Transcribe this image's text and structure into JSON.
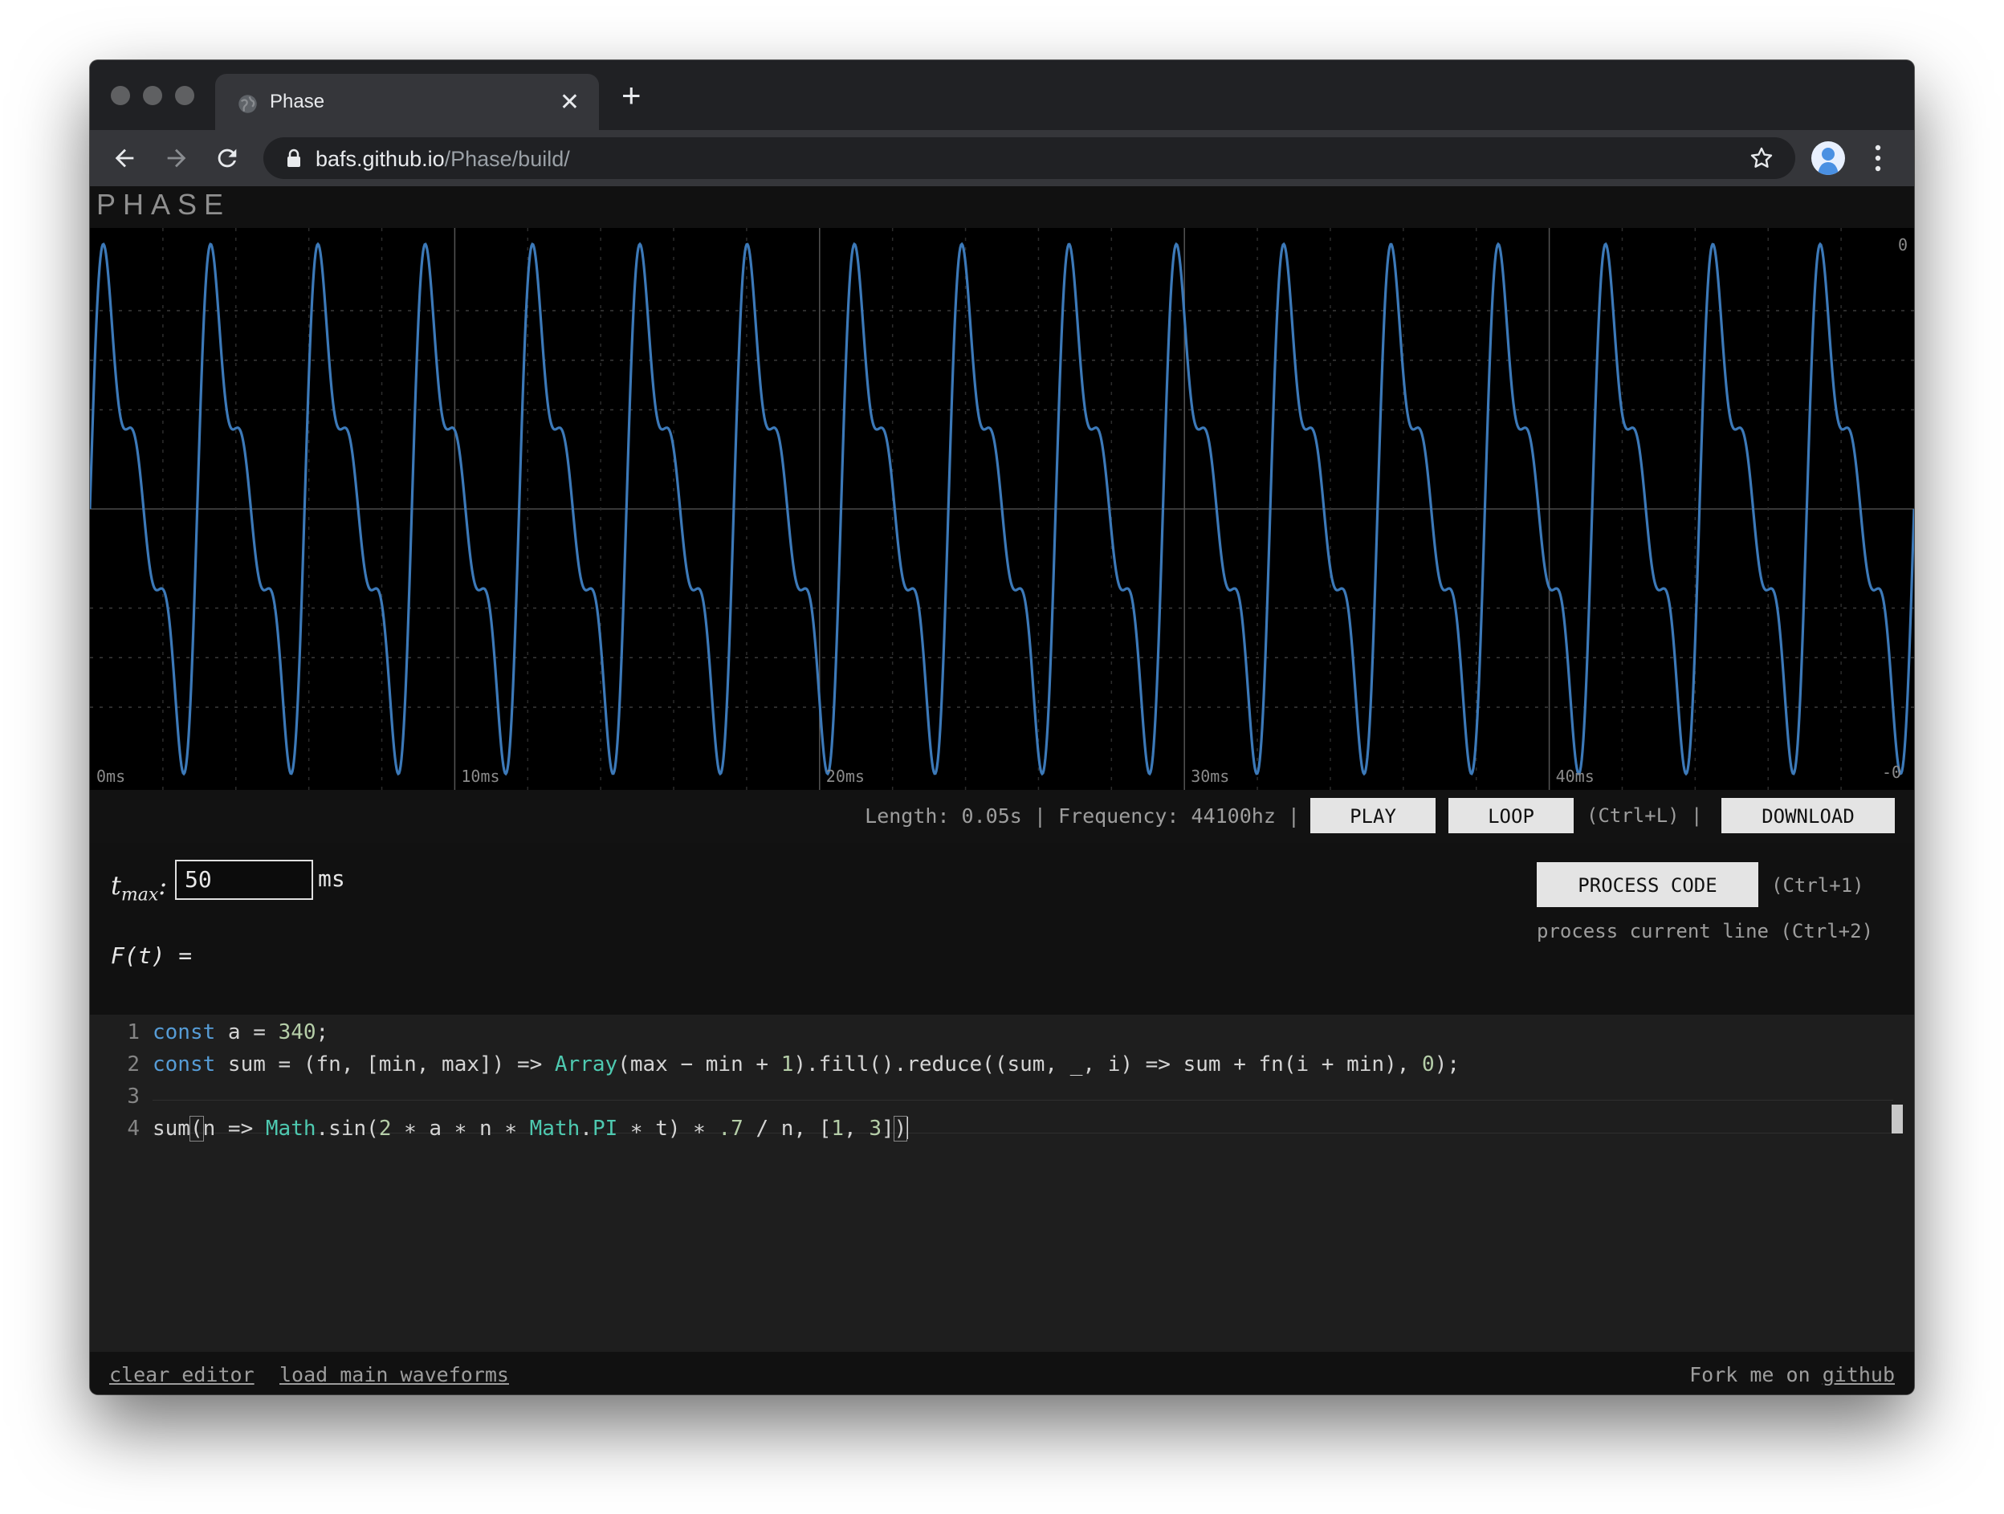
{
  "browser": {
    "tab_title": "Phase",
    "url_host": "bafs.github.io",
    "url_path": "/Phase/build/"
  },
  "app": {
    "brand": "PHASE"
  },
  "scope": {
    "time_labels": [
      "0ms",
      "10ms",
      "20ms",
      "30ms",
      "40ms"
    ],
    "y_top_label": "0",
    "y_bottom_label": "-0",
    "line_color": "#3c79b8"
  },
  "chart_data": {
    "type": "line",
    "x": [
      0,
      10,
      20,
      30,
      40
    ],
    "x_unit": "ms",
    "xlim": [
      0,
      50
    ],
    "ylim": [
      -1,
      1
    ],
    "tick_labels": [
      "0ms",
      "10ms",
      "20ms",
      "30ms",
      "40ms"
    ],
    "grid": true,
    "series": [
      {
        "frequency_hz": 340,
        "harmonics": [
          1,
          2,
          3
        ],
        "amplitude_per_harmonic": "0.7/n"
      }
    ]
  },
  "controls": {
    "info": "Length: 0.05s | Frequency: 44100hz |",
    "play_label": "PLAY",
    "loop_label": "LOOP",
    "loop_hint": "(Ctrl+L) |",
    "download_label": "DOWNLOAD",
    "process_label": "PROCESS CODE",
    "process_hint": "(Ctrl+1)",
    "process_line": "process current line (Ctrl+2)"
  },
  "tmax": {
    "label_main": "t",
    "label_sub": "max",
    "colon": ":",
    "value": "50",
    "unit": "ms"
  },
  "formula_label": "F(t) =",
  "editor": {
    "line_numbers": [
      "1",
      "2",
      "3",
      "4"
    ]
  },
  "footer": {
    "clear_label": "clear editor",
    "load_label": "load main waveforms",
    "fork_text": "Fork me on",
    "github_label": "github"
  }
}
